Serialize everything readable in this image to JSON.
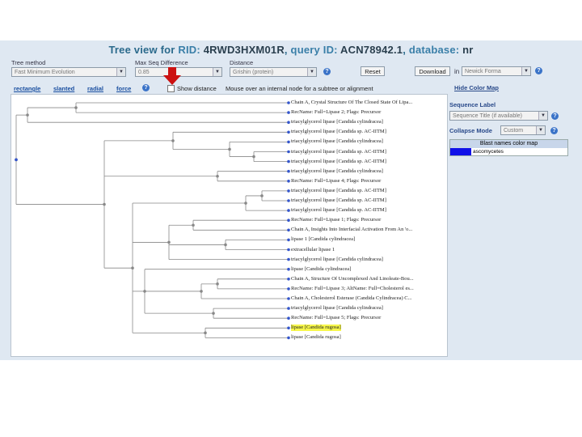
{
  "header": {
    "tree_view_for": "Tree view for",
    "rid_label": "RID:",
    "rid": "4RWD3HXM01R",
    "query_label": "query ID:",
    "query": "ACN78942.1",
    "database_label": "database:",
    "database": "nr"
  },
  "controls": {
    "tree_method_label": "Tree method",
    "tree_method_value": "Fast Minimum Evolution",
    "max_seq_label": "Max Seq Difference",
    "max_seq_value": "0.85",
    "distance_label": "Distance",
    "distance_value": "Grishin (protein)",
    "reset_label": "Reset",
    "download_label": "Download",
    "in_label": "in",
    "format_value": "Newick Forma"
  },
  "toolbar": {
    "tabs": [
      "rectangle",
      "slanted",
      "radial",
      "force"
    ],
    "show_distance_label": "Show distance",
    "hint": "Mouse over an internal node for a subtree or alignment"
  },
  "side": {
    "hide_color_map": "Hide Color Map",
    "sequence_label": "Sequence Label",
    "sequence_value": "Sequence Title (if available)",
    "collapse_mode_label": "Collapse Mode",
    "collapse_value": "Custom",
    "colormap_header": "Blast names color map",
    "colormap_entries": [
      {
        "name": "ascomycetes",
        "color": "#1010e8"
      }
    ]
  },
  "leaves": [
    "Chain A, Crystal Structure Of The Closed State Of Lipa...",
    "RecName: Full=Lipase 2; Flags: Precursor",
    "triacylglycerol lipase [Candida cylindracea]",
    "triacylglycerol lipase [Candida sp. AC-IITM]",
    "triacylglycerol lipase [Candida cylindracea]",
    "triacylglycerol lipase [Candida sp. AC-IITM]",
    "triacylglycerol lipase [Candida sp. AC-IITM]",
    "triacylglycerol lipase [Candida cylindracea]",
    "RecName: Full=Lipase 4; Flags: Precursor",
    "triacylglycerol lipase [Candida sp. AC-IITM]",
    "triacylglycerol lipase [Candida sp. AC-IITM]",
    "triacylglycerol lipase [Candida sp. AC-IITM]",
    "RecName: Full=Lipase 1; Flags: Precursor",
    "Chain A, Insights Into Interfacial Activation From An 'o...",
    "lipase 1 [Candida cylindracea]",
    "extracellular lipase 1",
    "triacylglycerol lipase [Candida cylindracea]",
    "lipase [Candida cylindracea]",
    "Chain A, Structure Of Uncomplexed And Linoleate-Bou...",
    "RecName: Full=Lipase 3; AltName: Full=Cholesterol es...",
    "Chain A, Cholesterol Esterase (Candida Cylindracea) C...",
    "triacylglycerol lipase [Candida cylindracea]",
    "RecName: Full=Lipase 5; Flags: Precursor",
    "lipase [Candida rugosa]",
    "lipase [Candida rugosa]"
  ],
  "highlighted_leaf_index": 23,
  "colors": {
    "accent": "#2b6a8c",
    "node": "#3355cc",
    "highlight": "#f7f74a",
    "arrow": "#cc1111"
  }
}
